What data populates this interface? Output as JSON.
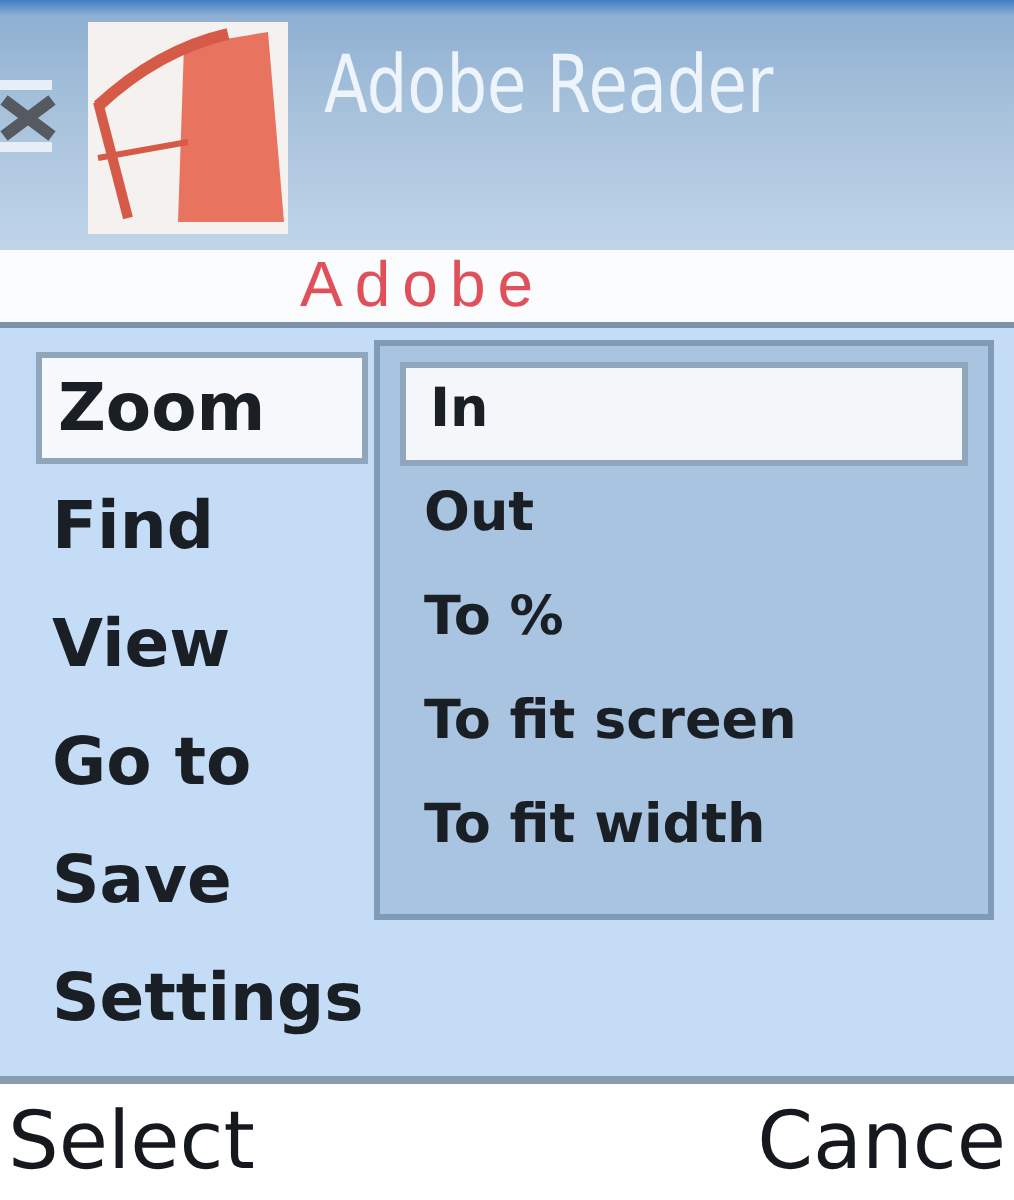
{
  "status_bar": {
    "title": "Adobe Reader"
  },
  "document": {
    "text": "Adobe"
  },
  "menu": {
    "items": [
      {
        "label": "Zoom",
        "selected": true
      },
      {
        "label": "Find",
        "selected": false
      },
      {
        "label": "View",
        "selected": false
      },
      {
        "label": "Go to",
        "selected": false
      },
      {
        "label": "Save",
        "selected": false
      },
      {
        "label": "Settings",
        "selected": false
      }
    ]
  },
  "submenu": {
    "items": [
      {
        "label": "In",
        "selected": true
      },
      {
        "label": "Out",
        "selected": false
      },
      {
        "label": "To %",
        "selected": false
      },
      {
        "label": "To fit screen",
        "selected": false
      },
      {
        "label": "To fit width",
        "selected": false
      }
    ]
  },
  "softkeys": {
    "left": "Select",
    "right": "Cance"
  }
}
